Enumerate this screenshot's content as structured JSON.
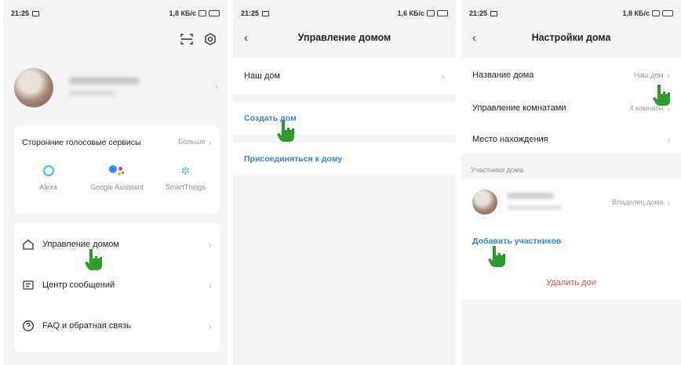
{
  "status_bars": [
    {
      "time": "21:25",
      "right": "1,8 КБ/с"
    },
    {
      "time": "21:25",
      "right": "1,6 КБ/с"
    },
    {
      "time": "21:25",
      "right": "1,8 КБ/с"
    }
  ],
  "panel1": {
    "icons": [
      "scan-icon",
      "gear-icon"
    ],
    "voice_services": {
      "title": "Сторонние голосовые сервисы",
      "more": "Больше",
      "items": [
        {
          "label": "Alexa",
          "icon": "alexa-icon"
        },
        {
          "label": "Google Assistant",
          "icon": "google-assistant-icon"
        },
        {
          "label": "SmartThings",
          "icon": "smartthings-icon"
        }
      ]
    },
    "menu": [
      {
        "label": "Управление домом",
        "icon": "home-icon"
      },
      {
        "label": "Центр сообщений",
        "icon": "message-icon"
      },
      {
        "label": "FAQ и обратная связь",
        "icon": "help-icon"
      }
    ]
  },
  "panel2": {
    "title": "Управление домом",
    "home_item": "Наш дом",
    "create_home": "Создать дом",
    "join_home": "Присоединяться к дому"
  },
  "panel3": {
    "title": "Настройки дома",
    "rows": [
      {
        "label": "Название дома",
        "value": "Наш дом"
      },
      {
        "label": "Управление комнатами",
        "value": "4 комнаты"
      },
      {
        "label": "Место нахождения",
        "value": ""
      }
    ],
    "members_section": "Участники дома",
    "member_role": "Владелец дома",
    "add_members": "Добавить участников",
    "delete_home": "Удалить дои"
  },
  "colors": {
    "accent": "#3d7fd6",
    "danger": "#e24d4d",
    "pointer": "#2f9a2f",
    "background": "#f3f4f6"
  }
}
